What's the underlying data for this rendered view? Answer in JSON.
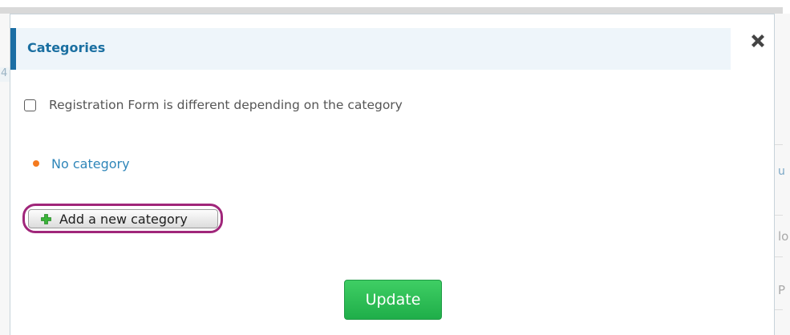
{
  "modal": {
    "title": "Categories",
    "close_icon": "close-icon",
    "option": {
      "label": "Registration Form is different depending on the category",
      "checked": false
    },
    "categories": [
      {
        "label": "No category"
      }
    ],
    "add_button": {
      "label": "Add a new category",
      "icon": "plus-icon"
    },
    "update_button": {
      "label": "Update"
    }
  },
  "background": {
    "left_glyph": "4",
    "right_glyphs": [
      "u",
      "lo",
      "P"
    ]
  },
  "colors": {
    "accent": "#1b6ea4",
    "header_bg": "#eef5fa",
    "link": "#2f86b9",
    "bullet": "#f47a1f",
    "highlight_ring": "#a0267a",
    "update_button": "#2bbd54",
    "plus_icon": "#3bb43a"
  }
}
